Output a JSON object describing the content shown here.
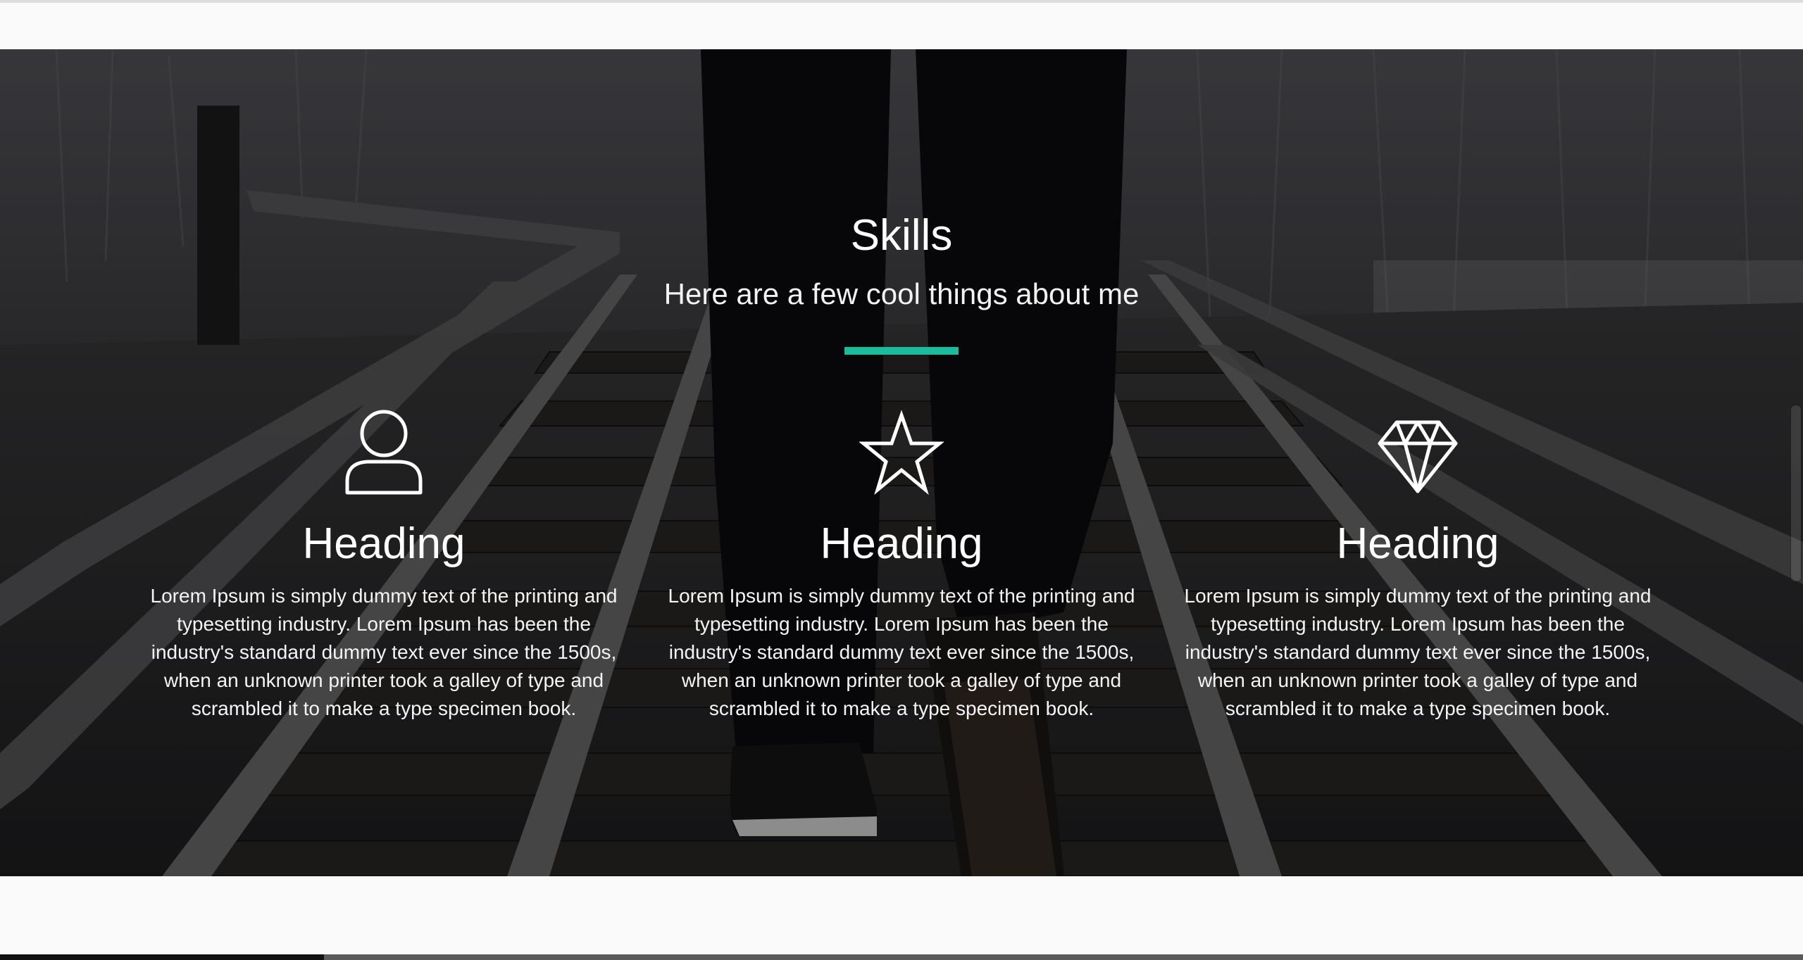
{
  "section": {
    "title": "Skills",
    "subtitle": "Here are a few cool things about me",
    "accent_color": "#1abc9c"
  },
  "skills": [
    {
      "icon": "user-icon",
      "heading": "Heading",
      "text": "Lorem Ipsum is simply dummy text of the printing and typesetting industry. Lorem Ipsum has been the industry's standard dummy text ever since the 1500s, when an unknown printer took a galley of type and scrambled it to make a type specimen book."
    },
    {
      "icon": "star-icon",
      "heading": "Heading",
      "text": "Lorem Ipsum is simply dummy text of the printing and typesetting industry. Lorem Ipsum has been the industry's standard dummy text ever since the 1500s, when an unknown printer took a galley of type and scrambled it to make a type specimen book."
    },
    {
      "icon": "diamond-icon",
      "heading": "Heading",
      "text": "Lorem Ipsum is simply dummy text of the printing and typesetting industry. Lorem Ipsum has been the industry's standard dummy text ever since the 1500s, when an unknown printer took a galley of type and scrambled it to make a type specimen book."
    }
  ]
}
